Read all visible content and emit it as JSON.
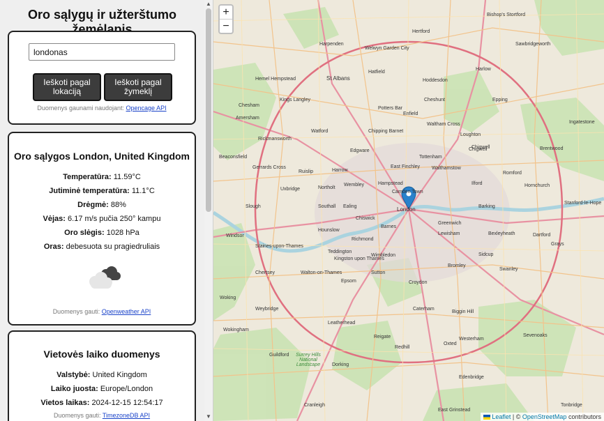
{
  "sidebar": {
    "title": "Oro sąlygų ir užterštumo žemėlapis",
    "search": {
      "value": "londonas",
      "placeholder": ""
    },
    "buttons": {
      "by_location": "Ieškoti pagal lokaciją",
      "by_marker": "Ieškoti pagal žymeklį"
    },
    "geo_credit": {
      "prefix": "Duomenys gaunami naudojant:",
      "link": "Opencage API"
    }
  },
  "weather": {
    "title": "Oro sąlygos London, United Kingdom",
    "temperature": {
      "label": "Temperatūra:",
      "value": "11.59°C"
    },
    "feels_like": {
      "label": "Jutiminė temperatūra:",
      "value": "11.1°C"
    },
    "humidity": {
      "label": "Drėgmė:",
      "value": "88%"
    },
    "wind": {
      "label": "Vėjas:",
      "value": "6.17 m/s pučia 250° kampu"
    },
    "pressure": {
      "label": "Oro slėgis:",
      "value": "1028 hPa"
    },
    "conditions": {
      "label": "Oras:",
      "value": "debesuota su pragiedruliais"
    },
    "icon": "broken-clouds-icon",
    "credit": {
      "prefix": "Duomenys gauti:",
      "link": "Openweather API"
    }
  },
  "location": {
    "title": "Vietovės laiko duomenys",
    "country": {
      "label": "Valstybė:",
      "value": "United Kingdom"
    },
    "timezone": {
      "label": "Laiko juosta:",
      "value": "Europe/London"
    },
    "local_time": {
      "label": "Vietos laikas:",
      "value": "2024-12-15 12:54:17"
    },
    "credit": {
      "prefix": "Duomenys gauti:",
      "link": "TimezoneDB API"
    }
  },
  "map": {
    "zoom_in": "+",
    "zoom_out": "−",
    "marker": "London",
    "attribution": {
      "leaflet": "Leaflet",
      "separator": "| ©",
      "osm": "OpenStreetMap",
      "suffix": "contributors"
    },
    "places": [
      "Hertford",
      "Bishop's Stortford",
      "Harpenden",
      "Welwyn Garden City",
      "Sawbridgeworth",
      "Hatfield",
      "Harlow",
      "St Albans",
      "Hemel Hempstead",
      "Hoddesdon",
      "Kings Langley",
      "Potters Bar",
      "Cheshunt",
      "Epping",
      "Chesham",
      "Watford",
      "Chipping Barnet",
      "Waltham Cross",
      "Loughton",
      "Amersham",
      "Ingatestone",
      "Brentwood",
      "Rickmansworth",
      "Edgware",
      "Chigwell",
      "Beaconsfield",
      "Gerrards Cross",
      "Ruislip",
      "Harrow",
      "Tottenham",
      "Walthamstow",
      "Romford",
      "Hornchurch",
      "Northolt",
      "Wembley",
      "Hampstead",
      "Ilford",
      "Uxbridge",
      "Southall",
      "Ealing",
      "London",
      "Barking",
      "Slough",
      "Chiswick",
      "Greenwich",
      "Lewisham",
      "Bexleyheath",
      "Dartford",
      "Hounslow",
      "Barnes",
      "Richmond",
      "Grays",
      "Windsor",
      "Staines-upon-Thames",
      "Teddington",
      "Kingston upon Thames",
      "Wimbledon",
      "Bromley",
      "Sidcup",
      "Swanley",
      "Chertsey",
      "Walton-on-Thames",
      "Epsom",
      "Sutton",
      "Croydon",
      "Woking",
      "Leatherhead",
      "Caterham",
      "Biggin Hill",
      "Sevenoaks",
      "Guildford",
      "Dorking",
      "Reigate",
      "Redhill",
      "Oxted",
      "Westerham",
      "Edenbridge",
      "East Grinstead",
      "Tonbridge",
      "Surrey Hills National Landscape",
      "Weybridge",
      "Wokingham",
      "Cranleigh",
      "Chigwell",
      "Enfield",
      "East Finchley",
      "Camden Town",
      "Stanford-le-Hope"
    ]
  }
}
